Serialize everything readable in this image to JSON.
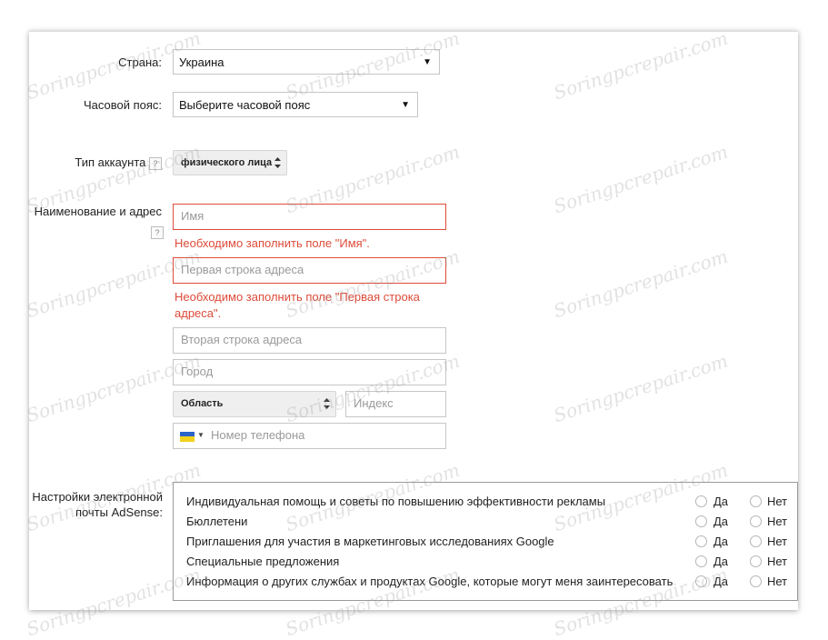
{
  "form": {
    "country": {
      "label": "Страна:",
      "value": "Украина"
    },
    "timezone": {
      "label": "Часовой пояс:",
      "value": "Выберите часовой пояс"
    },
    "account_type": {
      "label": "Тип аккаунта",
      "help": "?",
      "value": "физического лица"
    },
    "name_address": {
      "label": "Наименование и адрес",
      "help": "?",
      "name_placeholder": "Имя",
      "name_error": "Необходимо заполнить поле \"Имя\".",
      "address1_placeholder": "Первая строка адреса",
      "address1_error_line1": "Необходимо заполнить поле \"Первая строка",
      "address1_error_line2": "адреса\".",
      "address2_placeholder": "Вторая строка адреса",
      "city_placeholder": "Город",
      "region_value": "Область",
      "zip_placeholder": "Индекс",
      "phone_placeholder": "Номер телефона",
      "phone_flag_icon": "ukraine-flag-icon"
    },
    "email_prefs": {
      "label_line1": "Настройки электронной",
      "label_line2": "почты AdSense:",
      "yes_label": "Да",
      "no_label": "Нет",
      "items": [
        {
          "text": "Индивидуальная помощь и советы по повышению эффективности рекламы"
        },
        {
          "text": "Бюллетени"
        },
        {
          "text": "Приглашения для участия в маркетинговых исследованиях Google"
        },
        {
          "text": "Специальные предложения"
        },
        {
          "text": "Информация о других службах и продуктах Google, которые могут меня заинтересовать"
        }
      ]
    }
  },
  "watermark": "Soringpcrepair.com",
  "colors": {
    "error": "#dd4b39",
    "border": "#c6c6c6"
  }
}
